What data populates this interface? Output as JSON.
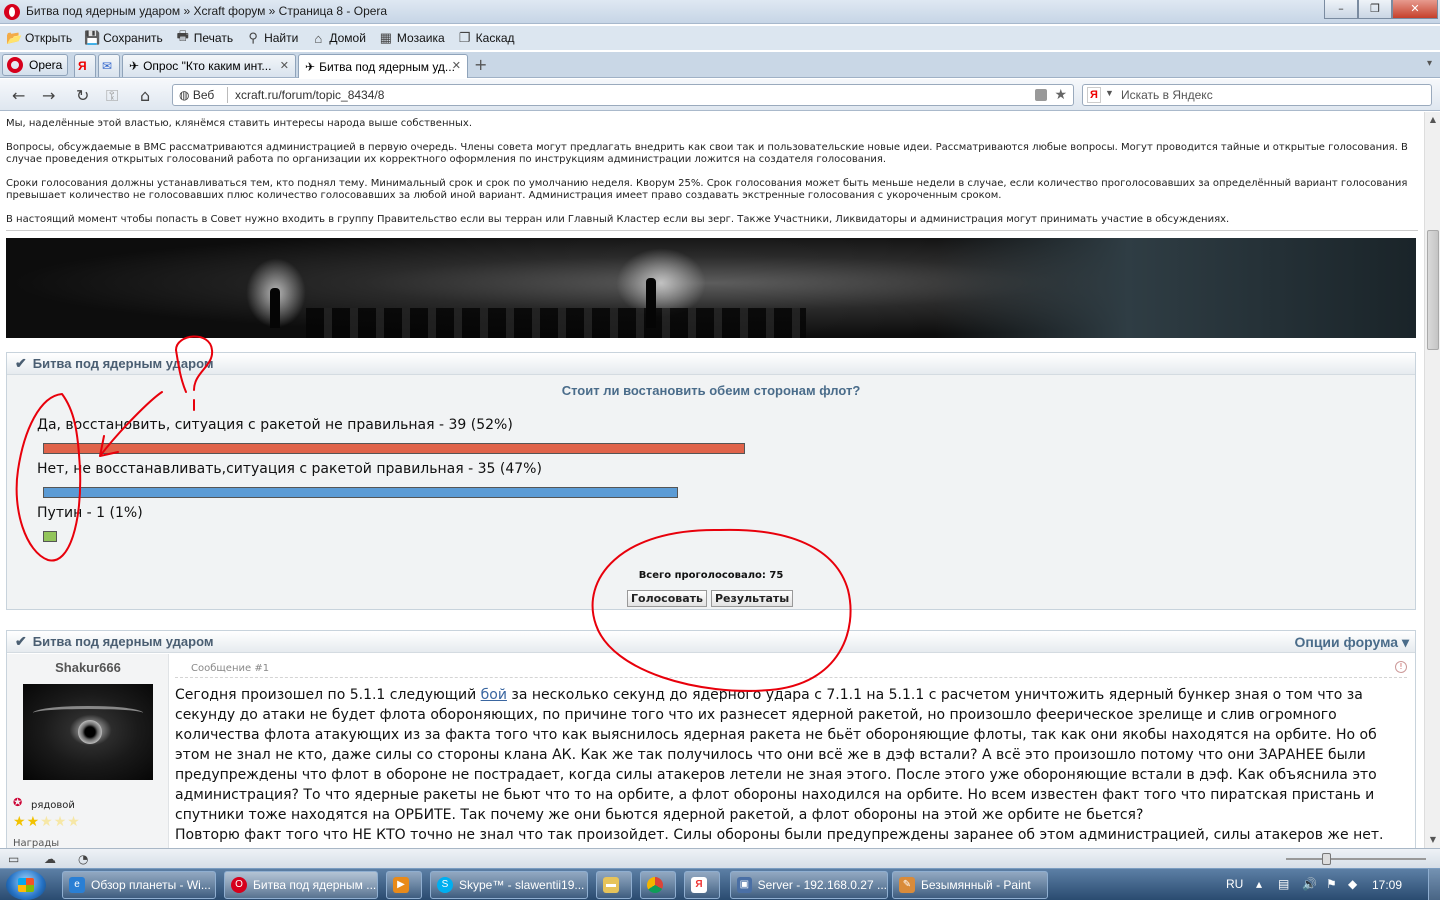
{
  "window": {
    "title": "Битва под ядерным ударом » Xcraft форум » Страница 8 - Opera",
    "controls": {
      "minimize": "–",
      "maximize": "❐",
      "close": "✕"
    }
  },
  "menu": [
    {
      "icon": "open-icon",
      "label": "Открыть"
    },
    {
      "icon": "save-icon",
      "label": "Сохранить"
    },
    {
      "icon": "print-icon",
      "label": "Печать"
    },
    {
      "icon": "find-icon",
      "label": "Найти"
    },
    {
      "icon": "home-icon",
      "label": "Домой"
    },
    {
      "icon": "tile-icon",
      "label": "Мозаика"
    },
    {
      "icon": "cascade-icon",
      "label": "Каскад"
    }
  ],
  "tabs": {
    "opera_button": "Opera",
    "items": [
      {
        "label": "Опрос \"Кто каким инт...",
        "active": false
      },
      {
        "label": "Битва под ядерным уд...",
        "active": true
      }
    ],
    "add": "+"
  },
  "address": {
    "web_label": "Веб",
    "url": "xcraft.ru/forum/topic_8434/8",
    "search_placeholder": "Искать в Яндекс",
    "search_logo": "Я"
  },
  "rules": [
    "Мы, наделённые этой властью, клянёмся ставить интересы народа выше собственных.",
    "Вопросы, обсуждаемые в ВМС рассматриваются администрацией в первую очередь. Члены совета могут предлагать внедрить как свои так и пользовательские новые идеи. Рассматриваются любые вопросы. Могут проводится тайные и открытые голосования. В случае проведения открытых голосований работа по организации их корректного оформления по инструкциям администрации ложится на создателя голосования.",
    "Сроки голосования должны устанавливаться тем, кто поднял тему. Минимальный срок и срок по умолчанию неделя. Кворум 25%. Срок голосования может быть меньше недели в случае, если количество проголосовавших за определённый вариант голосования превышает количество не голосовавших плюс количество голосовавших за любой иной вариант. Администрация имеет право создавать экстренные голосования с укороченным сроком.",
    "В настоящий момент чтобы попасть в Совет нужно входить в группу Правительство если вы терран или Главный Кластер если вы зерг. Также Участники, Ликвидаторы и администрация могут принимать участие в обсуждениях."
  ],
  "poll": {
    "header": "Битва под ядерным ударом",
    "question": "Стоит ли востановить обеим сторонам флот?",
    "options": [
      {
        "label": "Да, восстановить, ситуация с ракетой не правильная - 39 (52%)",
        "votes": 39,
        "percent": 52,
        "color": "#e0634a"
      },
      {
        "label": "Нет, не восстанавливать,ситуация с ракетой правильная - 35 (47%)",
        "votes": 35,
        "percent": 47,
        "color": "#5b9bd5"
      },
      {
        "label": "Путин - 1 (1%)",
        "votes": 1,
        "percent": 1,
        "color": "#92c45a"
      }
    ],
    "total_label": "Всего проголосовало: 75",
    "vote_button": "Голосовать",
    "results_button": "Результаты"
  },
  "post": {
    "header": "Битва под ядерным ударом",
    "forum_options": "Опции форума ▾",
    "author": "Shakur666",
    "rank": "рядовой",
    "stars_full": 2,
    "stars_total": 5,
    "awards_label": "Награды",
    "message_number": "Сообщение #1",
    "body_before_link": "Сегодня произошел по 5.1.1 следующий ",
    "body_link": "бой",
    "body_after_link": " за несколько секунд до ядерного удара с 7.1.1 на 5.1.1 с расчетом уничтожить ядерный бункер зная о том что за секунду до атаки не будет флота обороняющих, по причине того что их разнесет ядерной ракетой, но произошло феерическое зрелище и слив огромного количества флота атакующих из за факта того что как выяснилось ядерная ракета не бьёт обороняющие флоты, так как они якобы находятся на орбите. Но об этом не знал не кто, даже силы со стороны клана АК. Как же так получилось что они всё же в дэф встали? А всё это произошло потому что они ЗАРАНЕЕ были предупреждены что флот в обороне не пострадает, когда силы атакеров летели не зная этого. После этого уже обороняющие встали в дэф. Как объяснила это администрация? То что ядерные ракеты не бьют что то на орбите, а флот обороны находился на орбите. Но всем известен факт того что пиратская пристань и спутники тоже находятся на ОРБИТЕ. Так почему же они бьются ядерной ракетой, а флот обороны на этой же орбите не бьется?",
    "body_line2": "Повторю факт того что НЕ КТО точно не знал что так произойдет. Силы обороны были предупреждены заранее об этом администрацией, силы атакеров же нет."
  },
  "taskbar": {
    "items": [
      {
        "label": "Обзор планеты - Wi...",
        "icon": "ie-icon",
        "color": "#2a7fd4"
      },
      {
        "label": "Битва под ядерным ...",
        "icon": "opera-icon",
        "color": "#d6001c",
        "active": true
      },
      {
        "label": "",
        "icon": "media-player-icon",
        "color": "#e88a1a"
      },
      {
        "label": "Skype™ - slawentii19...",
        "icon": "skype-icon",
        "color": "#00aff0"
      },
      {
        "label": "",
        "icon": "folder-icon",
        "color": "#e6c35a"
      },
      {
        "label": "",
        "icon": "chrome-icon",
        "color": "#3aa757"
      },
      {
        "label": "",
        "icon": "yandex-icon",
        "color": "#e33"
      },
      {
        "label": "Server - 192.168.0.27 ...",
        "icon": "remote-desktop-icon",
        "color": "#4a6fa5"
      },
      {
        "label": "Безымянный - Paint",
        "icon": "paint-icon",
        "color": "#d98b3a"
      }
    ],
    "language": "RU",
    "clock": "17:09"
  }
}
